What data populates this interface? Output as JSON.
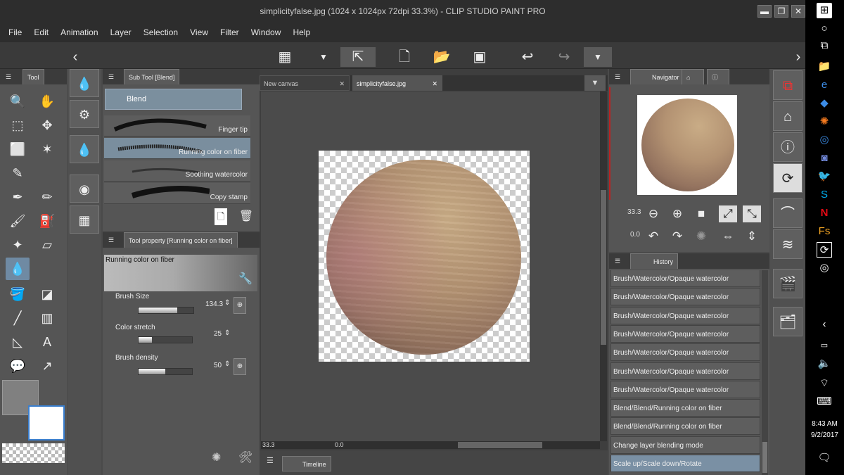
{
  "window": {
    "title": "simplicityfalse.jpg (1024 x 1024px 72dpi 33.3%)  - CLIP STUDIO PAINT PRO",
    "min": "▬",
    "max": "❐",
    "close": "✕"
  },
  "menu": [
    "File",
    "Edit",
    "Animation",
    "Layer",
    "Selection",
    "View",
    "Filter",
    "Window",
    "Help"
  ],
  "panels": {
    "tool_tab": "Tool",
    "subtool_tab": "Sub Tool [Blend]",
    "subtool_group": "Blend",
    "brushes": [
      "Finger tip",
      "Running color on fiber",
      "Soothing watercolor",
      "Copy stamp"
    ],
    "selected_brush": "Running color on fiber",
    "toolprop_tab": "Tool property [Running color on fiber]",
    "toolprop_preview": "Running color on fiber",
    "props": [
      {
        "label": "Brush Size",
        "value": "134.3",
        "fraction": 0.7
      },
      {
        "label": "Color stretch",
        "value": "25",
        "fraction": 0.25
      },
      {
        "label": "Brush density",
        "value": "50",
        "fraction": 0.5
      }
    ]
  },
  "doc_tabs": [
    "New canvas",
    "simplicityfalse.jpg"
  ],
  "status": {
    "zoom": "33.3",
    "angle": "0.0"
  },
  "timeline_tab": "Timeline",
  "navigator": {
    "tab": "Navigator",
    "zoom": "33.3",
    "rotation": "0.0"
  },
  "history": {
    "tab": "History",
    "items": [
      "Brush/Watercolor/Opaque watercolor",
      "Brush/Watercolor/Opaque watercolor",
      "Brush/Watercolor/Opaque watercolor",
      "Brush/Watercolor/Opaque watercolor",
      "Brush/Watercolor/Opaque watercolor",
      "Brush/Watercolor/Opaque watercolor",
      "Brush/Watercolor/Opaque watercolor",
      "Blend/Blend/Running color on fiber",
      "Blend/Blend/Running color on fiber",
      "Change layer blending mode",
      "Scale up/Scale down/Rotate"
    ],
    "selected_index": 10
  },
  "taskbar": {
    "time": "8:43 AM",
    "date": "9/2/2017"
  },
  "colors": {
    "accent": "#7a90a4",
    "selection_tool": "#6f8aa3"
  }
}
